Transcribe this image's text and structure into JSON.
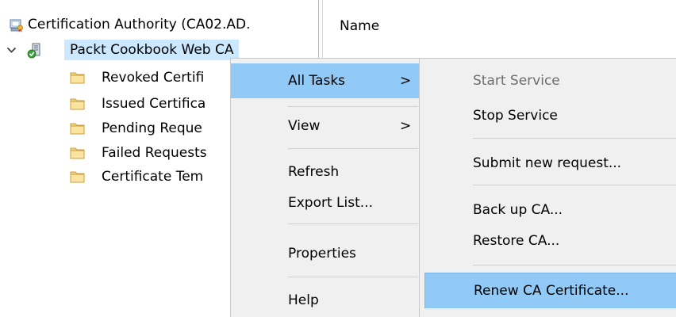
{
  "tree": {
    "root_label": "Certification Authority (CA02.AD.",
    "ca_label": "Packt Cookbook Web CA",
    "folders": [
      {
        "label": "Revoked Certifi"
      },
      {
        "label": "Issued Certifica"
      },
      {
        "label": "Pending Reque"
      },
      {
        "label": "Failed Requests"
      },
      {
        "label": "Certificate Tem"
      }
    ]
  },
  "results": {
    "column_header": "Name"
  },
  "context_menu": {
    "items": [
      {
        "label": "All Tasks",
        "arrow": ">"
      },
      {
        "label": "View",
        "arrow": ">"
      },
      {
        "label": "Refresh"
      },
      {
        "label": "Export List..."
      },
      {
        "label": "Properties"
      },
      {
        "label": "Help"
      }
    ]
  },
  "submenu": {
    "items": [
      {
        "label": "Start Service",
        "disabled": true
      },
      {
        "label": "Stop Service"
      },
      {
        "label": "Submit new request..."
      },
      {
        "label": "Back up CA..."
      },
      {
        "label": "Restore CA..."
      },
      {
        "label": "Renew CA Certificate..."
      }
    ]
  },
  "colors": {
    "selection": "#cce8ff",
    "menu_highlight": "#91c9f7",
    "menu_background": "#f0f0f0",
    "disabled_text": "#6d6d6d"
  },
  "icons": {
    "root": "certificate-authority-icon",
    "ca": "ca-server-icon",
    "folder": "folder-icon",
    "expand": "chevron-down-icon",
    "submenu_arrow": "chevron-right-icon"
  }
}
